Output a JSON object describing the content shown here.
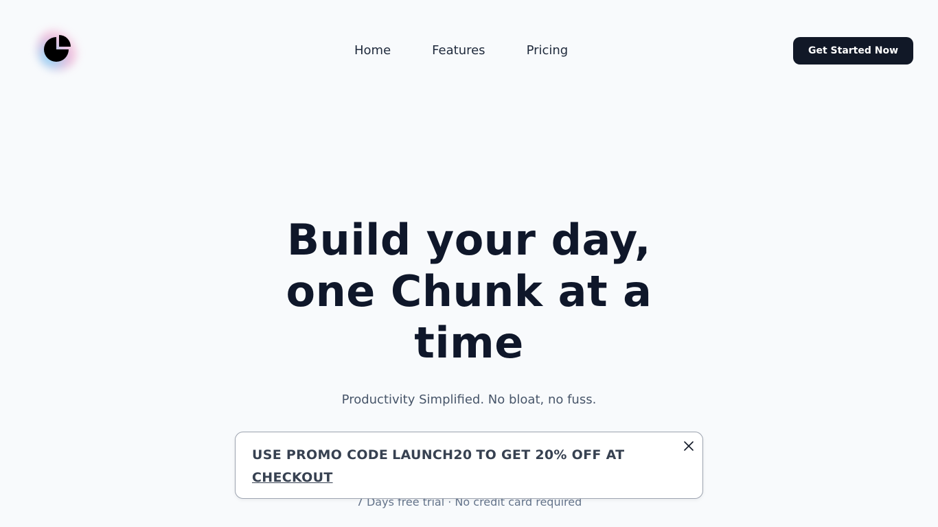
{
  "nav": {
    "items": [
      {
        "label": "Home"
      },
      {
        "label": "Features"
      },
      {
        "label": "Pricing"
      }
    ],
    "cta_label": "Get Started Now"
  },
  "hero": {
    "line1": "Build your day,",
    "line2_pre": "one",
    "line2_highlight": "Chunk",
    "line2_post": "at a",
    "line3": "time",
    "subtitle": "Productivity Simplified. No bloat, no fuss.",
    "trial_note": "7 Days free trial · No credit card required"
  },
  "promo": {
    "prefix": "USE PROMO CODE",
    "code": "LAUNCH20",
    "middle": "TO GET 20% OFF AT",
    "link": "CHECKOUT"
  },
  "icons": {
    "logo": "pie-chart-icon",
    "close": "close-icon"
  },
  "colors": {
    "background": "#f8fafc",
    "cta_background": "#111827",
    "heading": "#0f172a"
  }
}
